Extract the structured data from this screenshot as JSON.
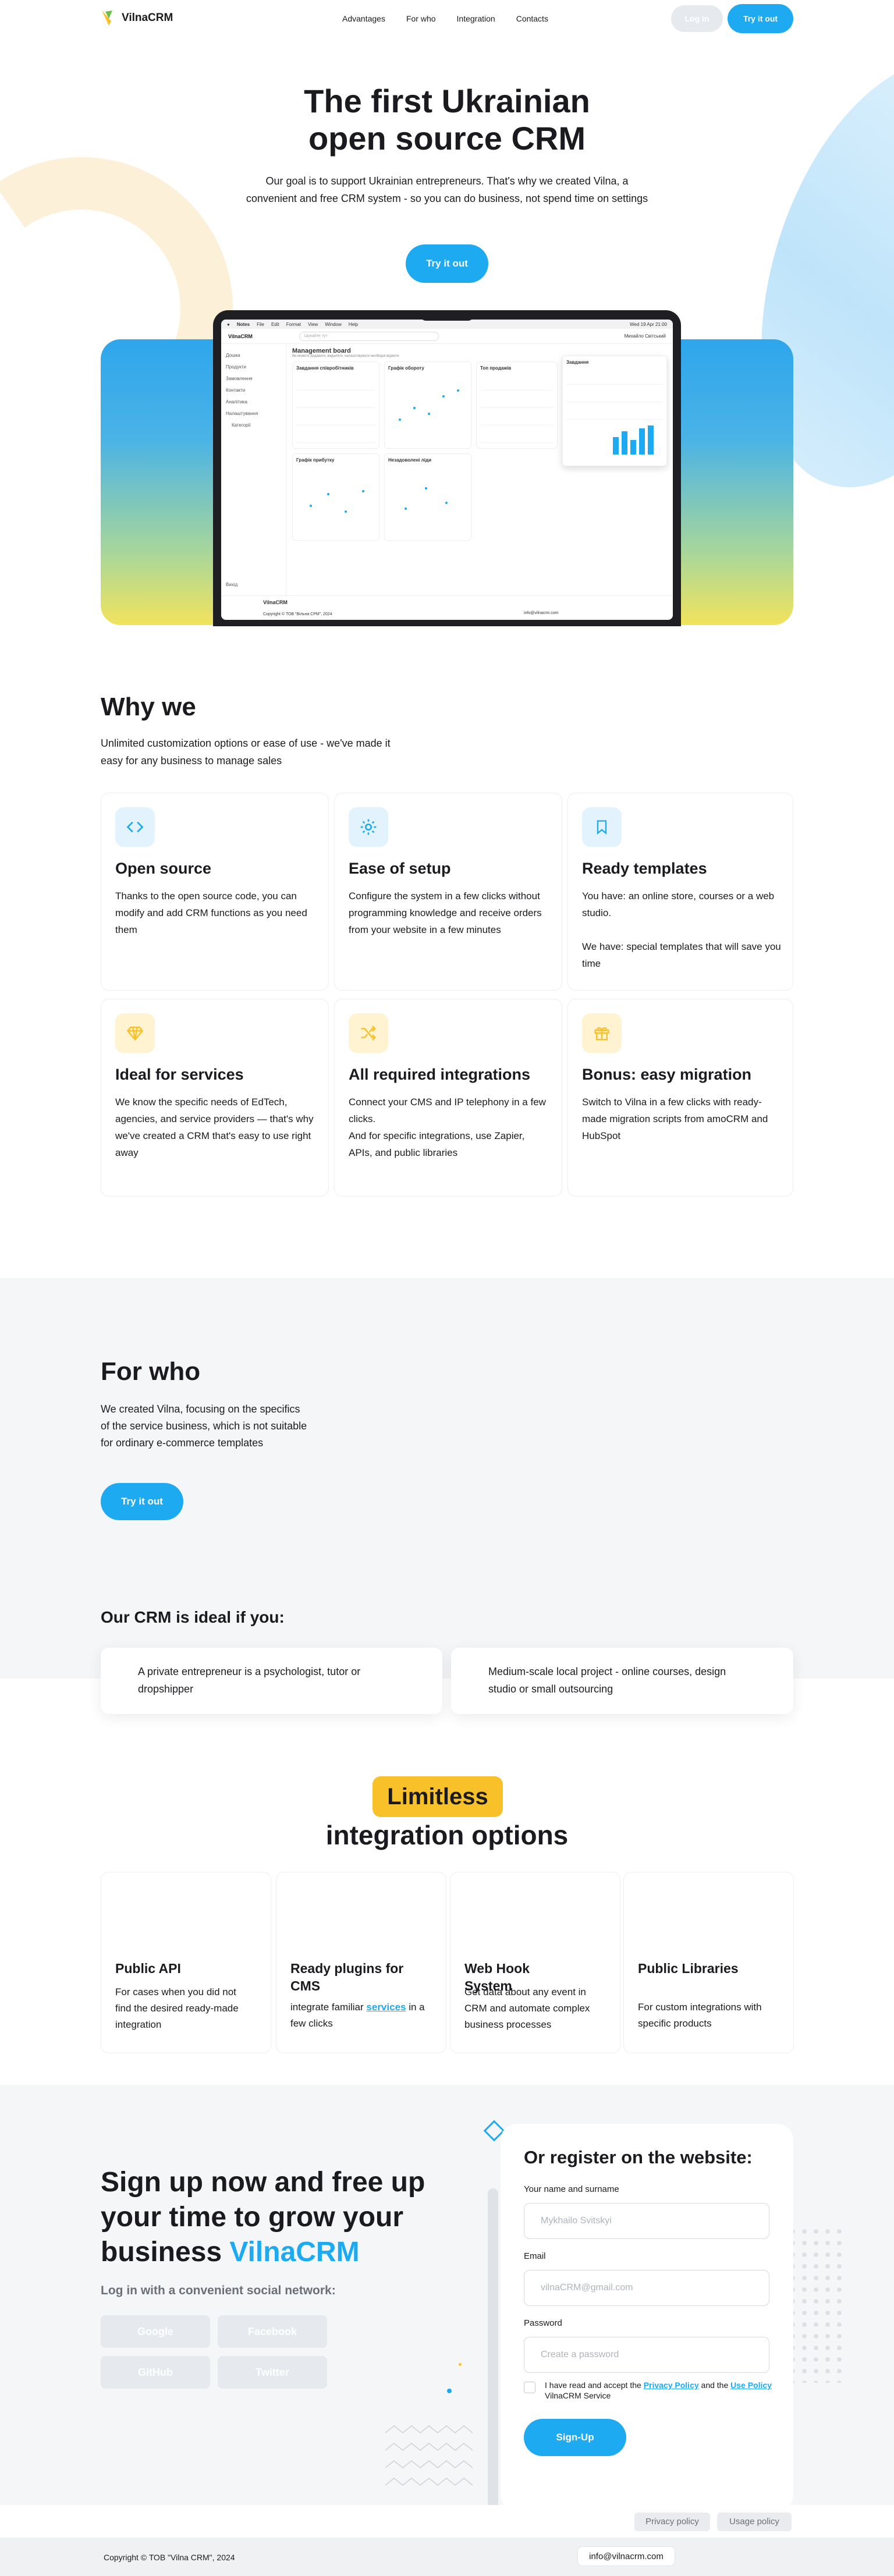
{
  "header": {
    "logo_text": "VilnaCRM",
    "nav": [
      "Advantages",
      "For who",
      "Integration",
      "Contacts"
    ],
    "login_label": "Log in",
    "try_label": "Try it out"
  },
  "hero": {
    "title_line1": "The first Ukrainian",
    "title_line2": "open source CRM",
    "subtitle": "Our goal is to support Ukrainian entrepreneurs. That's why we created Vilna, a convenient and free CRM system - so you can do business, not spend time on settings",
    "cta": "Try it out"
  },
  "mockup": {
    "mac_menu": [
      "Notes",
      "File",
      "Edit",
      "Format",
      "View",
      "Window",
      "Help"
    ],
    "mac_time": "Wed 19 Apr 21:00",
    "app_logo": "VilnaCRM",
    "search_placeholder": "Шукайте тут",
    "user_name": "Михайло Світський",
    "sidebar": [
      "Дошка",
      "Продукти",
      "Замовлення",
      "Контакти",
      "Аналітика",
      "Налаштування",
      "Категорії"
    ],
    "sidebar_exit": "Вихід",
    "board_title": "Management board",
    "board_sub": "Ви можете додавати, видаляти, налаштовувати необхідні віджети",
    "panels": [
      "Завдання співробітників",
      "Графік обороту",
      "Топ продажів",
      "Графік прибутку",
      "Незадоволені ліди",
      "Завдання"
    ],
    "footer_logo": "VilnaCRM",
    "footer_copy": "Copyright © ТОВ \"Вільна СРМ\", 2024",
    "footer_email": "info@vilnacrm.com"
  },
  "why": {
    "title": "Why we",
    "subtitle": "Unlimited customization options or ease of use - we've made it easy for any business to manage sales",
    "cards": [
      {
        "icon": "code-icon",
        "title": "Open source",
        "text": "Thanks to the open source code, you can modify and add CRM functions as you need them"
      },
      {
        "icon": "gear-icon",
        "title": "Ease of setup",
        "text": "Configure the system in a few clicks without programming knowledge and receive orders from your website in a few minutes"
      },
      {
        "icon": "bookmark-icon",
        "title": "Ready templates",
        "text": "You have: an online store, courses or a web studio.\n\nWe have: special templates that will save you time"
      },
      {
        "icon": "diamond-icon",
        "title": "Ideal for services",
        "text": "We know the specific needs of EdTech, agencies, and service providers — that's why we've created a CRM that's easy to use right away"
      },
      {
        "icon": "shuffle-icon",
        "title": "All required integrations",
        "text": "Connect your CMS and IP telephony in a few clicks.\nAnd for specific integrations, use Zapier, APIs, and public libraries"
      },
      {
        "icon": "gift-icon",
        "title": "Bonus: easy migration",
        "text": "Switch to Vilna in a few clicks with ready-made migration scripts from amoCRM and HubSpot"
      }
    ]
  },
  "forwho": {
    "title": "For who",
    "text": "We created Vilna, focusing on the specifics of the service business, which is not suitable for ordinary e-commerce templates",
    "cta": "Try it out",
    "ideal_title": "Our CRM is ideal if you:",
    "ideal_items": [
      "A private entrepreneur is a psychologist, tutor or dropshipper",
      "Medium-scale local project - online courses, design studio or small outsourcing"
    ]
  },
  "integrations": {
    "badge": "Limitless",
    "title": "integration options",
    "cards": [
      {
        "title": "Public API",
        "text": "For cases when you did not find the desired ready-made integration"
      },
      {
        "title": "Ready plugins for CMS",
        "text_before": "integrate familiar",
        "link": "services",
        "text_after": "in a few clicks"
      },
      {
        "title": "Web Hook System",
        "text": "Get data about any event in CRM and automate complex business processes"
      },
      {
        "title": "Public Libraries",
        "text": "For custom integrations with specific products"
      }
    ]
  },
  "signup": {
    "title_main": "Sign up now and free up your time to grow your business",
    "title_accent": "VilnaCRM",
    "social_label": "Log in with a convenient social network:",
    "social": [
      "Google",
      "Facebook",
      "GitHub",
      "Twitter"
    ],
    "form": {
      "title": "Or register on the website:",
      "name_label": "Your name and surname",
      "name_placeholder": "Mykhailo Svitskyi",
      "email_label": "Email",
      "email_placeholder": "vilnaCRM@gmail.com",
      "password_label": "Password",
      "password_placeholder": "Create a password",
      "terms_before": "I have read and accept the",
      "privacy_link": "Privacy Policy",
      "terms_and": "and the",
      "use_link": "Use Policy",
      "terms_after": "VilnaCRM Service",
      "submit": "Sign-Up"
    }
  },
  "footer": {
    "privacy": "Privacy policy",
    "usage": "Usage policy",
    "copyright": "Copyright © ТОВ \"Vilna CRM\", 2024",
    "email": "info@vilnacrm.com"
  },
  "colors": {
    "accent": "#1eaaf1",
    "yellow": "#f8c12a",
    "bg_gray": "#f5f6f8"
  }
}
